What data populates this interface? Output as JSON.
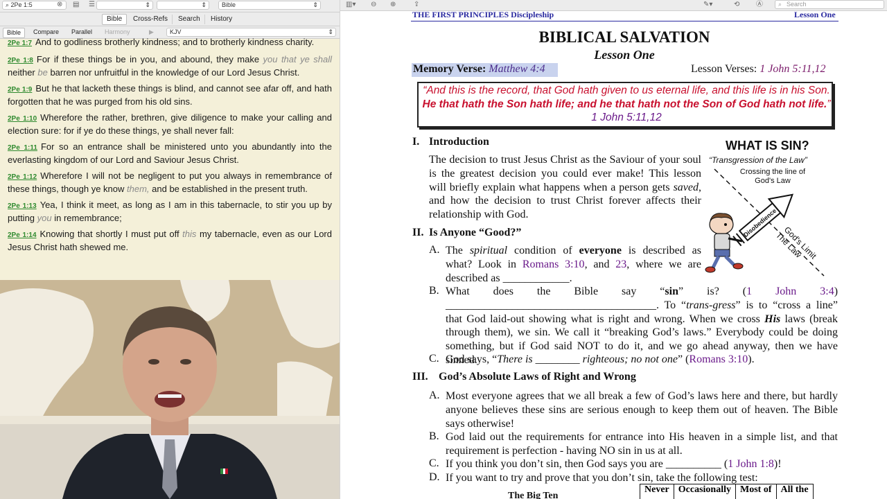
{
  "bible_app": {
    "toolbar": {
      "reference_value": "2Pe 1:5",
      "bible_select": "Bible"
    },
    "tabs": [
      "Bible",
      "Cross-Refs",
      "Search",
      "History"
    ],
    "modes": [
      "Bible",
      "Compare",
      "Parallel",
      "Harmony"
    ],
    "play_symbol": "▶",
    "translation": "KJV",
    "verses": [
      {
        "ref": "2Pe 1:7",
        "parts": [
          {
            "t": "And to godliness brotherly kindness; and to brotherly kindness charity."
          }
        ]
      },
      {
        "ref": "2Pe 1:8",
        "parts": [
          {
            "t": "For if these things be in you, and abound, they make "
          },
          {
            "t": "you that ye shall",
            "i": true
          },
          {
            "t": " neither "
          },
          {
            "t": "be",
            "i": true
          },
          {
            "t": " barren nor unfruitful in the knowledge of our Lord Jesus Christ."
          }
        ]
      },
      {
        "ref": "2Pe 1:9",
        "parts": [
          {
            "t": "But he that lacketh these things is blind, and cannot see afar off, and hath forgotten that he was purged from his old sins."
          }
        ]
      },
      {
        "ref": "2Pe 1:10",
        "parts": [
          {
            "t": "Wherefore the rather, brethren, give diligence to make your calling and election sure: for if ye do these things, ye shall never fall:"
          }
        ]
      },
      {
        "ref": "2Pe 1:11",
        "parts": [
          {
            "t": "For so an entrance shall be ministered unto you abundantly into the everlasting kingdom of our Lord and Saviour Jesus Christ."
          }
        ]
      },
      {
        "ref": "2Pe 1:12",
        "parts": [
          {
            "t": "Wherefore I will not be negligent to put you always in remembrance of these things, though ye know "
          },
          {
            "t": "them,",
            "i": true
          },
          {
            "t": " and be established in the present truth."
          }
        ]
      },
      {
        "ref": "2Pe 1:13",
        "parts": [
          {
            "t": "Yea, I think it meet, as long as I am in this tabernacle, to stir you up by putting "
          },
          {
            "t": "you",
            "i": true
          },
          {
            "t": " in remembrance;"
          }
        ]
      },
      {
        "ref": "2Pe 1:14",
        "parts": [
          {
            "t": "Knowing that shortly I must put off "
          },
          {
            "t": "this",
            "i": true
          },
          {
            "t": " my tabernacle, even as our Lord Jesus Christ hath shewed me."
          }
        ]
      }
    ]
  },
  "pdf_viewer": {
    "search_placeholder": "Search",
    "header_left": "THE FIRST PRINCIPLES Discipleship",
    "header_right": "Lesson One",
    "title": "BIBLICAL SALVATION",
    "subtitle": "Lesson One",
    "memory_verse_label": "Memory Verse:",
    "memory_verse_ref": "Matthew 4:4",
    "lesson_verses_label": "Lesson Verses:",
    "lesson_verses_ref": "1 John 5:11,12",
    "quote": {
      "open": "“And this is the record, that God hath given to us eternal life, and this life is in his Son. ",
      "bold": "He that hath the Son hath life; and he that hath not the Son of God hath not life.",
      "close": "”",
      "ref": "1 John 5:11,12"
    },
    "sec1_num": "I.",
    "sec1_title": "Introduction",
    "sec1_text": {
      "a": "The decision to trust Jesus Christ as the Saviour of your soul is the greatest decision you could ever make! This lesson will briefly explain what happens when a person gets ",
      "i": "saved",
      "b": ", and how the decision to trust Christ forever affects their relationship with God."
    },
    "sin_graphic": {
      "title": "WHAT IS SIN?",
      "subtitle": "“Transgression of the Law”",
      "crossing": "Crossing the line of God's Law",
      "arrow_label": "Disobedience",
      "limit_label": "God's Limit",
      "law_label": "The Law"
    },
    "sec2_num": "II.",
    "sec2_title": "Is Anyone “Good?”",
    "sec2_items": {
      "A_letter": "A.",
      "A_1": "The ",
      "A_2": "spiritual",
      "A_3": " condition of ",
      "A_4": "everyone",
      "A_5": " is described as what? Look in ",
      "A_ref1": "Romans 3:10",
      "A_6": ", and ",
      "A_ref2": "23",
      "A_7": ", where we are described as ____________.",
      "B_letter": "B.",
      "B_1": "What does the Bible say “",
      "B_2": "sin",
      "B_3": "” is? (",
      "B_ref": "1 John 3:4",
      "B_4": ") ______________________________________. To “",
      "B_5": "trans-gress",
      "B_6": "” is to “cross a line” that God laid-out showing what is right and wrong. When we cross ",
      "B_7": "His",
      "B_8": " laws (break through them), we sin. We call it “breaking God’s laws.” Everybody could be doing something, but if God said NOT to do it, and we go ahead anyway, then we have sinned.",
      "C_letter": "C.",
      "C_1": "God says, “",
      "C_2": "There is ________ righteous; no not one",
      "C_3": "” (",
      "C_ref": "Romans 3:10",
      "C_4": ")."
    },
    "sec3_num": "III.",
    "sec3_title": "God’s Absolute Laws of Right and Wrong",
    "sec3_items": {
      "A_letter": "A.",
      "A": "Most everyone agrees that we all break a few of God’s laws here and there, but hardly anyone believes these sins are serious enough to keep them out of heaven. The Bible says otherwise!",
      "B_letter": "B.",
      "B": "God laid out the requirements for entrance into His heaven in a simple list, and that requirement is perfection - having NO sin in us at all.",
      "C_letter": "C.",
      "C_1": "If you think you don’t sin, then God says you are __________ (",
      "C_ref": "1 John 1:8",
      "C_2": ")!",
      "D_letter": "D.",
      "D": "If you want to try and prove that you don’t sin, take the following test:"
    },
    "big_ten_label": "The Big Ten",
    "table_headers": [
      "Never",
      "Occasionally",
      "Most of",
      "All the"
    ]
  },
  "colors": {
    "verse_ref": "#2f8a2f",
    "quote_red": "#c8102e",
    "link_purple": "#6a1a8a",
    "header_blue": "#2a2aa0",
    "memory_highlight": "#c9d3ee"
  }
}
